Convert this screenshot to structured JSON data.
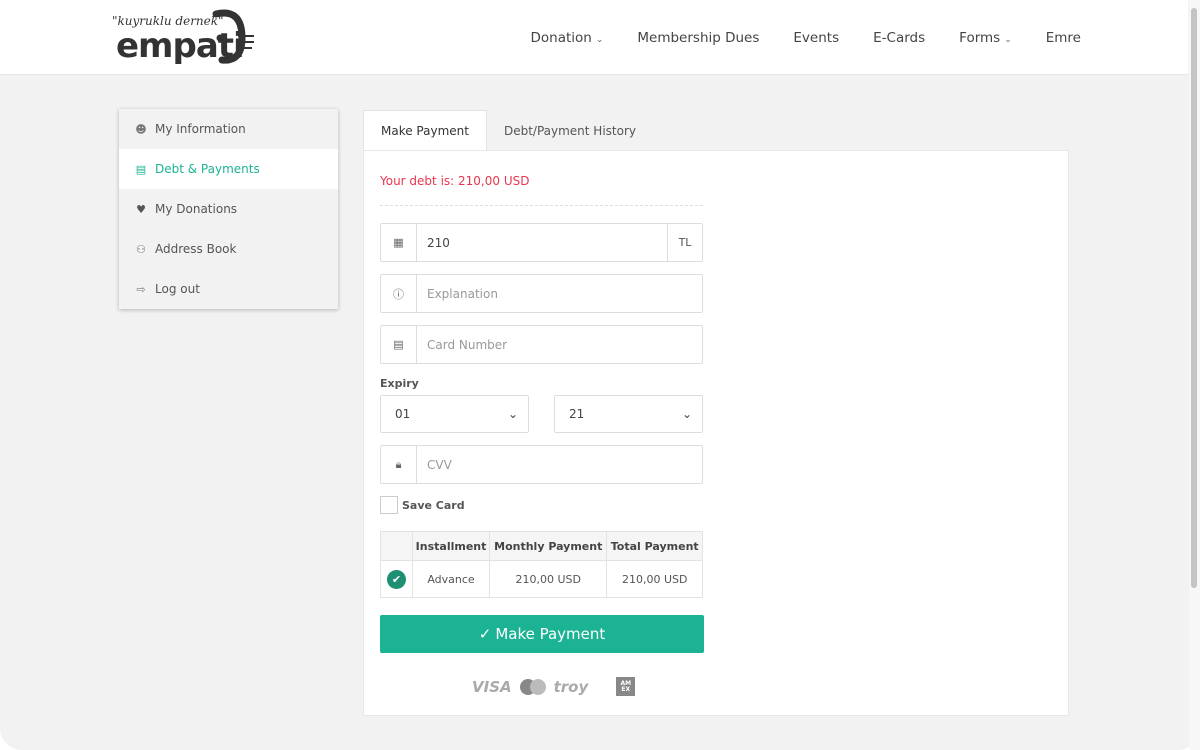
{
  "header": {
    "logo_tagline": "\"kuyruklu dernek\"",
    "logo_word": "empati",
    "nav": [
      {
        "label": "Donation",
        "dropdown": true
      },
      {
        "label": "Membership Dues"
      },
      {
        "label": "Events"
      },
      {
        "label": "E-Cards"
      },
      {
        "label": "Forms",
        "dropdown": true
      },
      {
        "label": "Emre"
      }
    ]
  },
  "sidebar": {
    "items": [
      {
        "label": "My Information",
        "icon": "user-icon"
      },
      {
        "label": "Debt & Payments",
        "icon": "card-icon",
        "active": true
      },
      {
        "label": "My Donations",
        "icon": "heart-icon"
      },
      {
        "label": "Address Book",
        "icon": "users-icon"
      },
      {
        "label": "Log out",
        "icon": "logout-icon"
      }
    ]
  },
  "tabs": [
    {
      "label": "Make Payment",
      "active": true
    },
    {
      "label": "Debt/Payment History"
    }
  ],
  "form": {
    "debt_text": "Your debt is: 210,00 USD",
    "amount": {
      "value": "210",
      "suffix": "TL"
    },
    "explanation_placeholder": "Explanation",
    "card_placeholder": "Card Number",
    "expiry_label": "Expiry",
    "expiry_month": "01",
    "expiry_year": "21",
    "cvv_placeholder": "CVV",
    "save_card_label": "Save Card",
    "save_card_checked": false,
    "table": {
      "headers": [
        "",
        "Installment",
        "Monthly Payment",
        "Total Payment"
      ],
      "rows": [
        {
          "selected": true,
          "installment": "Advance",
          "monthly": "210,00 USD",
          "total": "210,00 USD"
        }
      ]
    },
    "submit_label": "Make Payment",
    "card_logos": [
      "VISA",
      "troy",
      "AM EX"
    ]
  },
  "colors": {
    "accent": "#1bb394",
    "debt": "#e8364e"
  }
}
